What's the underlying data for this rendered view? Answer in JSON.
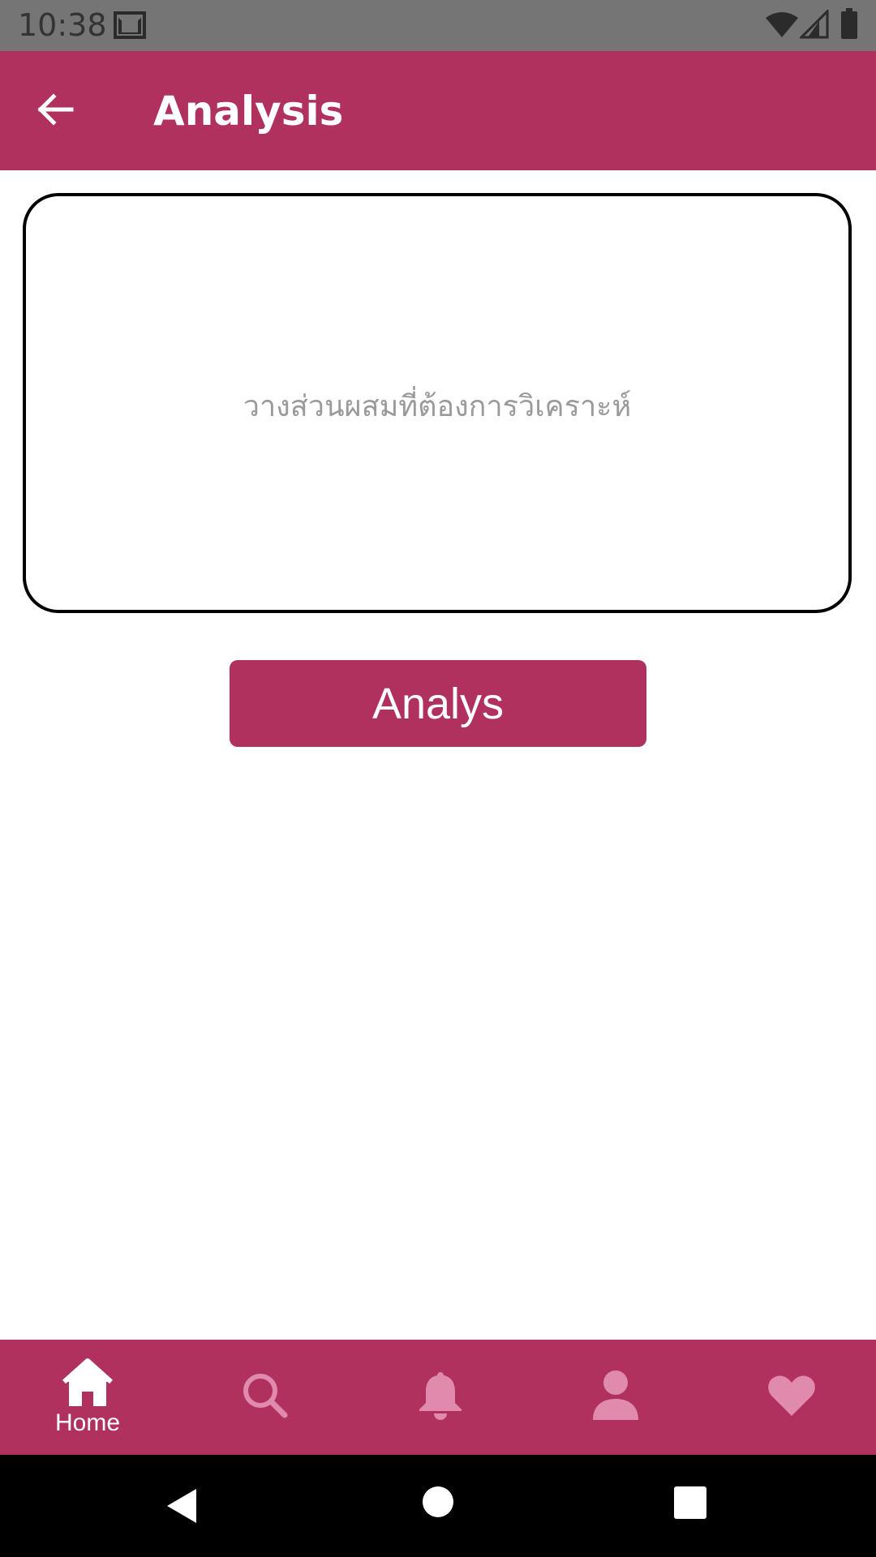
{
  "status_bar": {
    "time": "10:38",
    "icons": [
      "gmail-icon",
      "wifi-icon",
      "signal-icon",
      "battery-icon"
    ]
  },
  "app_bar": {
    "title": "Analysis",
    "back_icon": "arrow-left-icon",
    "background_color": "#b0305e"
  },
  "ingredient_input": {
    "value": "",
    "placeholder": "วางส่วนผสมที่ต้องการวิเคราะห์"
  },
  "analyze_button": {
    "label": "Analys",
    "color": "#b0305e"
  },
  "bottom_nav": {
    "items": [
      {
        "icon": "home-icon",
        "label": "Home",
        "active": true
      },
      {
        "icon": "search-icon",
        "label": "",
        "active": false
      },
      {
        "icon": "bell-icon",
        "label": "",
        "active": false
      },
      {
        "icon": "person-icon",
        "label": "",
        "active": false
      },
      {
        "icon": "heart-icon",
        "label": "",
        "active": false
      }
    ],
    "active_color": "#ffffff",
    "inactive_color": "#e08aae"
  },
  "system_nav": {
    "buttons": [
      "back-triangle-icon",
      "home-circle-icon",
      "recents-square-icon"
    ]
  }
}
